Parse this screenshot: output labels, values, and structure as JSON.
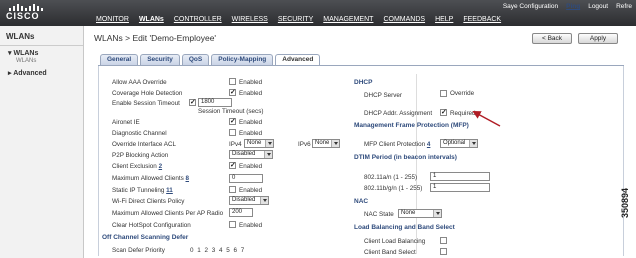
{
  "header": {
    "logo_text": "CISCO",
    "top_links": [
      "Saye Configuration",
      "Ping",
      "Logout",
      "Refre"
    ],
    "nav": [
      "MONITOR",
      "WLANs",
      "CONTROLLER",
      "WIRELESS",
      "SECURITY",
      "MANAGEMENT",
      "COMMANDS",
      "HELP",
      "FEEDBACK"
    ]
  },
  "sidebar": {
    "title": "WLANs",
    "items": [
      {
        "label": "▾ WLANs",
        "sub": "WLANs"
      },
      {
        "label": "▸ Advanced"
      }
    ]
  },
  "page": {
    "title": "WLANs > Edit  'Demo-Employee'",
    "back_label": "< Back",
    "apply_label": "Apply"
  },
  "tabs": [
    "General",
    "Security",
    "QoS",
    "Policy-Mapping",
    "Advanced"
  ],
  "left_settings": {
    "allow_aaa": {
      "label": "Allow AAA Override",
      "value": "Enabled"
    },
    "coverage_hole": {
      "label": "Coverage Hole Detection",
      "value": "Enabled"
    },
    "session_timeout": {
      "label": "Enable Session Timeout",
      "value": "1800",
      "unit": "Session Timeout (secs)"
    },
    "aironet_ie": {
      "label": "Aironet IE",
      "value": "Enabled"
    },
    "diag_channel": {
      "label": "Diagnostic Channel",
      "value": "Enabled"
    },
    "override_acl": {
      "label": "Override Interface ACL",
      "ipv4_label": "IPv4",
      "ipv4_value": "None",
      "ipv6_label": "IPv6",
      "ipv6_value": "None"
    },
    "p2p_blocking": {
      "label": "P2P Blocking Action",
      "value": "Disabled"
    },
    "client_exclusion": {
      "label": "Client Exclusion",
      "ref": "2",
      "value": "Enabled"
    },
    "max_clients": {
      "label": "Maximum Allowed Clients",
      "ref": "8",
      "value": "0"
    },
    "static_ip": {
      "label": "Static IP Tunneling",
      "ref": "11",
      "value": "Enabled"
    },
    "wifi_direct": {
      "label": "Wi-Fi Direct Clients Policy",
      "value": "Disabled"
    },
    "max_per_ap": {
      "label": "Maximum Allowed Clients Per AP Radio",
      "value": "200"
    },
    "hotspot": {
      "label": "Clear HotSpot Configuration",
      "value": "Enabled"
    },
    "off_channel": {
      "title": "Off Channel Scanning Defer"
    },
    "scan_defer": {
      "label": "Scan Defer Priority",
      "values": "0  1  2  3  4  5  6  7"
    }
  },
  "right_settings": {
    "dhcp": {
      "title": "DHCP",
      "server_label": "DHCP Server",
      "override_label": "Override",
      "assignment_label": "DHCP Addr. Assignment",
      "required_label": "Required"
    },
    "mfp": {
      "title": "Management Frame Protection (MFP)",
      "label": "MFP Client Protection",
      "ref": "4",
      "value": "Optional"
    },
    "dtim": {
      "title": "DTIM Period (in beacon intervals)",
      "a_label": "802.11a/n (1 - 255)",
      "a_value": "1",
      "bg_label": "802.11b/g/n (1 - 255)",
      "bg_value": "1"
    },
    "nac": {
      "title": "NAC",
      "label": "NAC State",
      "value": "None"
    },
    "lb": {
      "title": "Load Balancing and Band Select",
      "load_label": "Client Load Balancing",
      "band_label": "Client Band Select"
    }
  },
  "figure_id": "350894",
  "colors": {
    "accent": "#2f4b7c",
    "arrow": "#b01c24"
  }
}
